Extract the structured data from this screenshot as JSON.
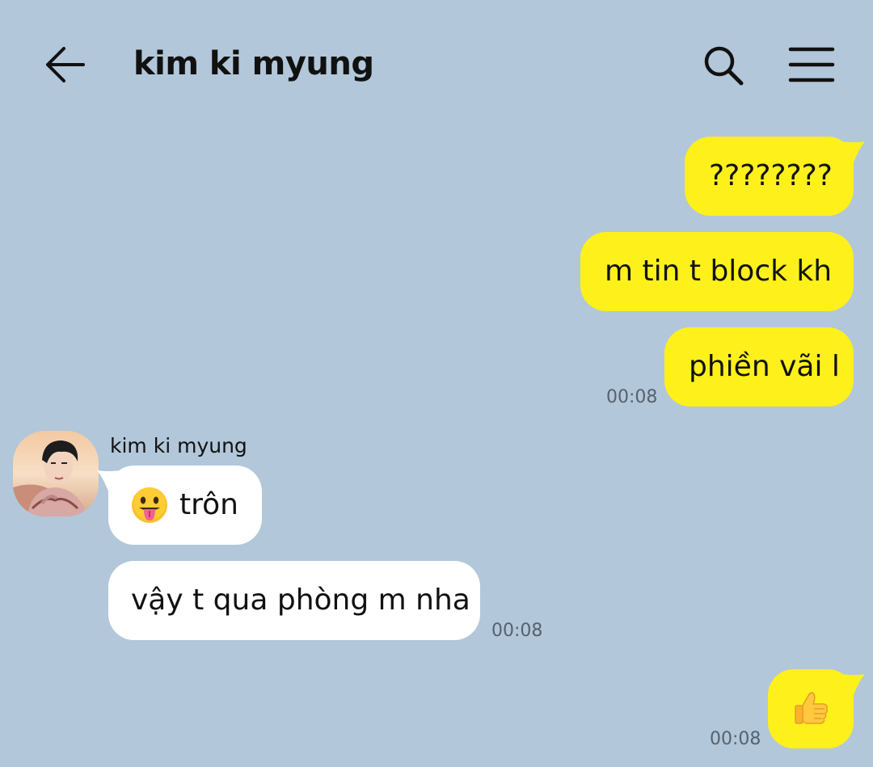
{
  "header": {
    "title": "kim ki myung",
    "back_icon": "arrow-left-icon",
    "search_icon": "search-icon",
    "menu_icon": "hamburger-menu-icon"
  },
  "colors": {
    "background": "#b2c7d9",
    "my_bubble": "#fef01b",
    "their_bubble": "#ffffff"
  },
  "messages": [
    {
      "from": "me",
      "text": "????????"
    },
    {
      "from": "me",
      "text": "m tin t block kh"
    },
    {
      "from": "me",
      "text": "phiền vãi l",
      "time": "00:08"
    },
    {
      "from": "them",
      "sender": "kim ki myung",
      "emoji": "face-with-tongue-emoji",
      "text": "trôn"
    },
    {
      "from": "them",
      "text": "vậy t qua phòng m nha",
      "time": "00:08"
    },
    {
      "from": "me",
      "emoji": "thumbs-up-emoji",
      "text": "",
      "time": "00:08"
    }
  ]
}
